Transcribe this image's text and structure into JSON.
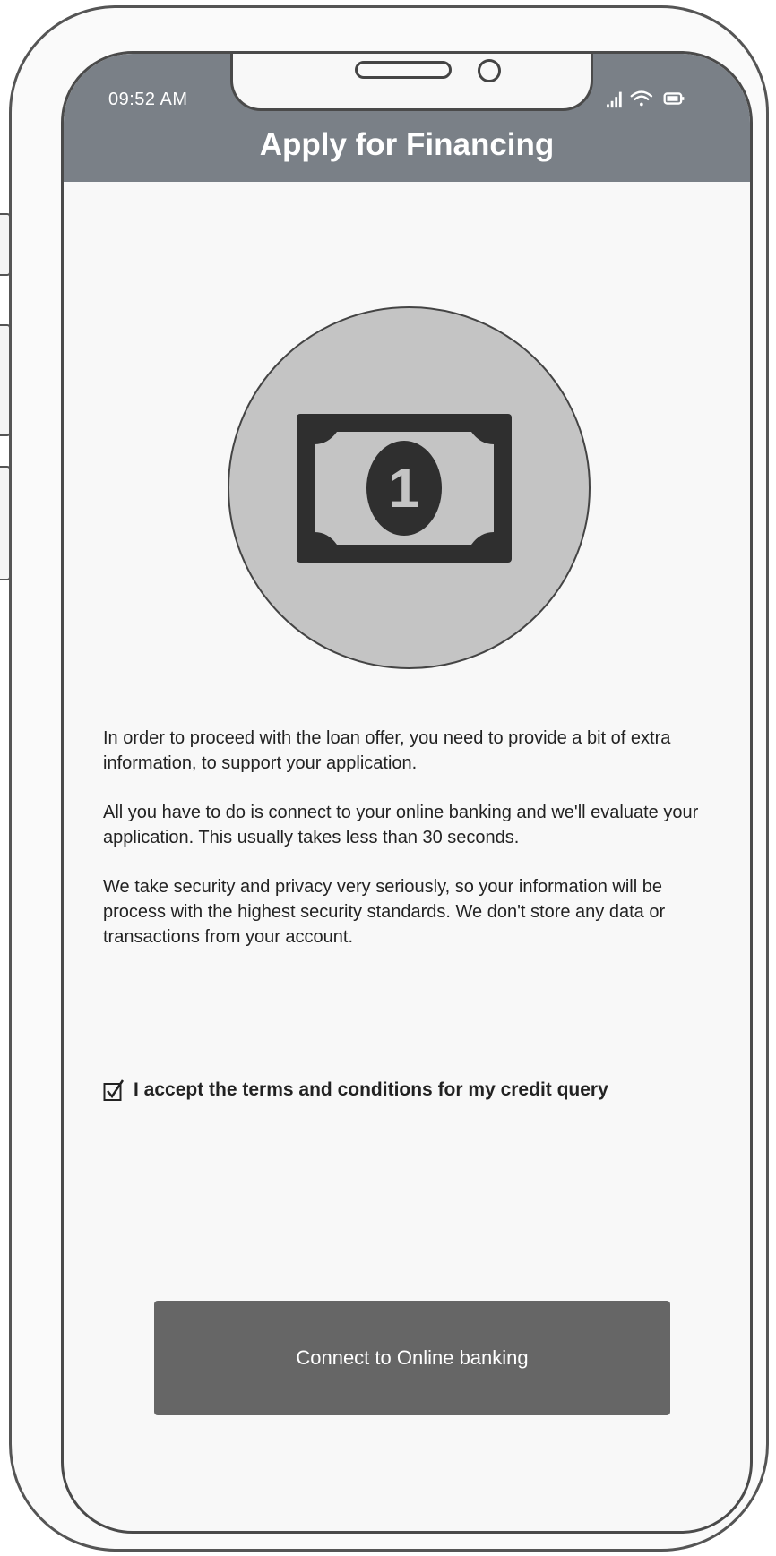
{
  "status_bar": {
    "time": "09:52 AM",
    "icons": [
      "signal-icon",
      "wifi-icon",
      "battery-icon"
    ]
  },
  "header": {
    "title": "Apply for Financing",
    "background_color": "#7a8087"
  },
  "hero": {
    "icon": "dollar-bill-icon",
    "bill_digit": "1"
  },
  "content": {
    "paragraph_1": "In order to proceed with the loan offer, you need to provide a bit of extra information, to support your application.",
    "paragraph_2": "All you have to do is connect to your online banking and we'll evaluate your application. This usually takes less than 30 seconds.",
    "paragraph_3": "We take security and privacy very seriously, so your information will be process with the highest security standards. We don't store any data or transactions from your account."
  },
  "terms": {
    "checked": true,
    "label": "I accept the terms and conditions for my credit query"
  },
  "cta": {
    "label": "Connect to Online banking",
    "color": "#666666"
  }
}
